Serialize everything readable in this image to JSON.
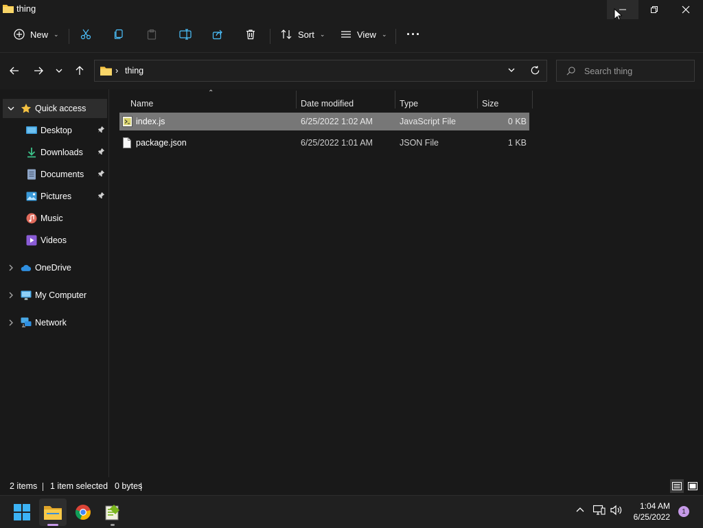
{
  "window": {
    "title": "thing"
  },
  "toolbar": {
    "new_label": "New",
    "sort_label": "Sort",
    "view_label": "View",
    "more_label": "···"
  },
  "address": {
    "path": "thing",
    "search_placeholder": "Search thing"
  },
  "sidebar": {
    "quick_access": "Quick access",
    "items": [
      {
        "label": "Desktop",
        "icon": "desktop-icon",
        "pinned": true
      },
      {
        "label": "Downloads",
        "icon": "download-icon",
        "pinned": true
      },
      {
        "label": "Documents",
        "icon": "documents-icon",
        "pinned": true
      },
      {
        "label": "Pictures",
        "icon": "pictures-icon",
        "pinned": true
      },
      {
        "label": "Music",
        "icon": "music-icon",
        "pinned": false
      },
      {
        "label": "Videos",
        "icon": "videos-icon",
        "pinned": false
      }
    ],
    "onedrive": "OneDrive",
    "mycomputer": "My Computer",
    "network": "Network"
  },
  "columns": {
    "name": "Name",
    "date": "Date modified",
    "type": "Type",
    "size": "Size"
  },
  "files": [
    {
      "name": "index.js",
      "date": "6/25/2022 1:02 AM",
      "type": "JavaScript File",
      "size": "0 KB",
      "selected": true
    },
    {
      "name": "package.json",
      "date": "6/25/2022 1:01 AM",
      "type": "JSON File",
      "size": "1 KB",
      "selected": false
    }
  ],
  "status": {
    "item_count": "2 items",
    "selection": "1 item selected",
    "selection_size": "0 bytes"
  },
  "taskbar": {
    "time": "1:04 AM",
    "date": "6/25/2022",
    "notifications": "1"
  },
  "colors": {
    "accent": "#0078d4",
    "folder": "#f5c242",
    "selection": "#777777"
  }
}
